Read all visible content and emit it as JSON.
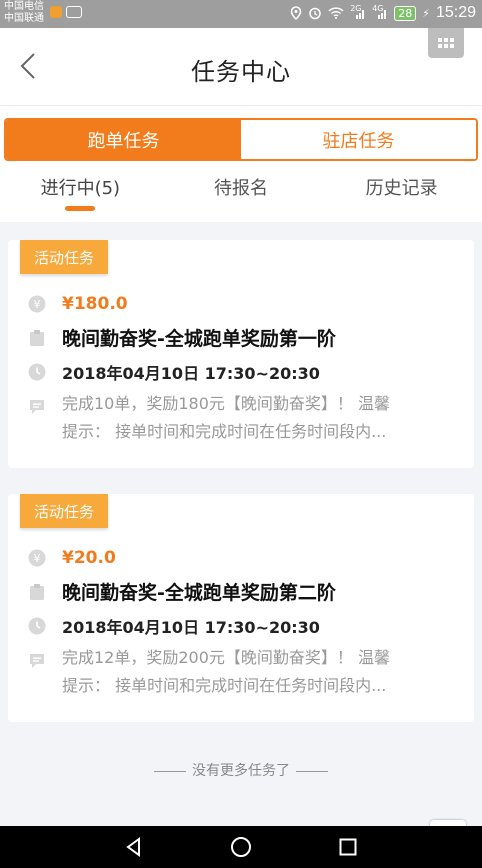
{
  "statusbar": {
    "carrier1": "中国电信",
    "carrier2": "中国联通",
    "battery": "28",
    "time": "15:29",
    "net1": "2G",
    "net2": "4G"
  },
  "header": {
    "title": "任务中心",
    "back_icon": "chevron-left-icon",
    "grid_icon": "grid-menu-icon"
  },
  "segment": {
    "items": [
      {
        "label": "跑单任务",
        "active": true
      },
      {
        "label": "驻店任务",
        "active": false
      }
    ]
  },
  "tabs": [
    {
      "label": "进行中(5)",
      "active": true
    },
    {
      "label": "待报名",
      "active": false
    },
    {
      "label": "历史记录",
      "active": false
    }
  ],
  "cards": [
    {
      "badge": "活动任务",
      "price": "¥180.0",
      "title": "晚间勤奋奖-全城跑单奖励第一阶",
      "time": "2018年04月10日 17:30~20:30",
      "desc_line1": "完成10单，奖励180元【晚间勤奋奖】！ 温馨",
      "desc_line2": "提示： 接单时间和完成时间在任务时间段内..."
    },
    {
      "badge": "活动任务",
      "price": "¥20.0",
      "title": "晚间勤奋奖-全城跑单奖励第二阶",
      "time": "2018年04月10日 17:30~20:30",
      "desc_line1": "完成12单，奖励200元【晚间勤奋奖】！ 温馨",
      "desc_line2": "提示： 接单时间和完成时间在任务时间段内..."
    }
  ],
  "footer": {
    "no_more": "没有更多任务了"
  },
  "colors": {
    "accent": "#f27b1c",
    "badge": "#f7a93c"
  }
}
